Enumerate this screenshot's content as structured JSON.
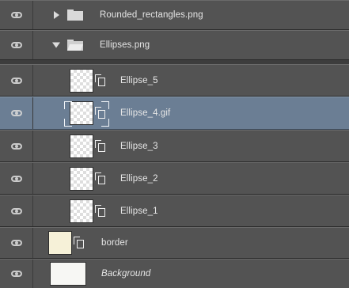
{
  "layers_panel": {
    "rows": [
      {
        "name": "Rounded_rectangles.png",
        "type": "group",
        "expanded": false,
        "selected": false,
        "visible": true
      },
      {
        "name": "Ellipses.png",
        "type": "group",
        "expanded": true,
        "selected": false,
        "visible": true
      },
      {
        "name": "Ellipse_5",
        "type": "smart-object",
        "selected": false,
        "visible": true
      },
      {
        "name": "Ellipse_4.gif",
        "type": "smart-object",
        "selected": true,
        "visible": true
      },
      {
        "name": "Ellipse_3",
        "type": "smart-object",
        "selected": false,
        "visible": true
      },
      {
        "name": "Ellipse_2",
        "type": "smart-object",
        "selected": false,
        "visible": true
      },
      {
        "name": "Ellipse_1",
        "type": "smart-object",
        "selected": false,
        "visible": true
      },
      {
        "name": "border",
        "type": "smart-object",
        "selected": false,
        "visible": true
      },
      {
        "name": "Background",
        "type": "background",
        "selected": false,
        "visible": true,
        "italic": true
      }
    ]
  },
  "colors": {
    "row_bg": "#535353",
    "selected_row_bg": "#6b7e94",
    "text": "#e6e6e6",
    "border_thumb": "#f6f1d8",
    "background_thumb": "#f7f7f4"
  },
  "icons": {
    "visibility": "eye-icon",
    "collapsed_group": "chevron-right-icon",
    "expanded_group": "chevron-down-icon",
    "group": "folder-icon",
    "open_group": "folder-open-icon",
    "smart_object": "smart-object-link-icon"
  }
}
